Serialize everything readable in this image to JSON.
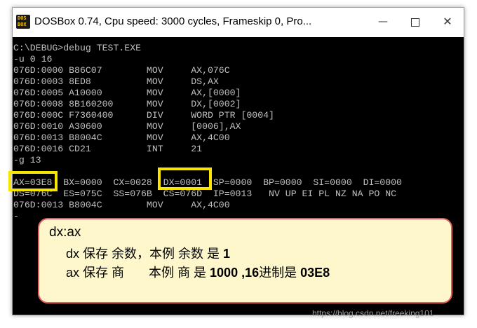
{
  "window": {
    "title": "DOSBox 0.74, Cpu speed:     3000 cycles, Frameskip  0, Pro...",
    "icon_line1": "DOS",
    "icon_line2": "BOX",
    "minimize": "—",
    "close": "✕"
  },
  "console": {
    "lines": [
      "C:\\DEBUG>debug TEST.EXE",
      "-u 0 16",
      "076D:0000 B86C07        MOV     AX,076C",
      "076D:0003 8ED8          MOV     DS,AX",
      "076D:0005 A10000        MOV     AX,[0000]",
      "076D:0008 8B160200      MOV     DX,[0002]",
      "076D:000C F7360400      DIV     WORD PTR [0004]",
      "076D:0010 A30600        MOV     [0006],AX",
      "076D:0013 B8004C        MOV     AX,4C00",
      "076D:0016 CD21          INT     21",
      "-g 13",
      "",
      "AX=03E8  BX=0000  CX=0028  DX=0001  SP=0000  BP=0000  SI=0000  DI=0000",
      "DS=076C  ES=075C  SS=076B  CS=076D  IP=0013   NV UP EI PL NZ NA PO NC",
      "076D:0013 B8004C        MOV     AX,4C00",
      "-"
    ]
  },
  "annotation": {
    "line1": "dx:ax",
    "line2_a": "dx 保存 余数，本例 余数 是 ",
    "line2_b": "1",
    "line3_a": "ax 保存 商       本例 商 是 ",
    "line3_b": "1000 ,16",
    "line3_c": "进制是 ",
    "line3_d": "03E8",
    "border_color": "#e35b5b",
    "fill_color": "#fef7cc",
    "highlight_color": "#f8e600"
  },
  "watermark": "https://blog.csdn.net/freeking101"
}
